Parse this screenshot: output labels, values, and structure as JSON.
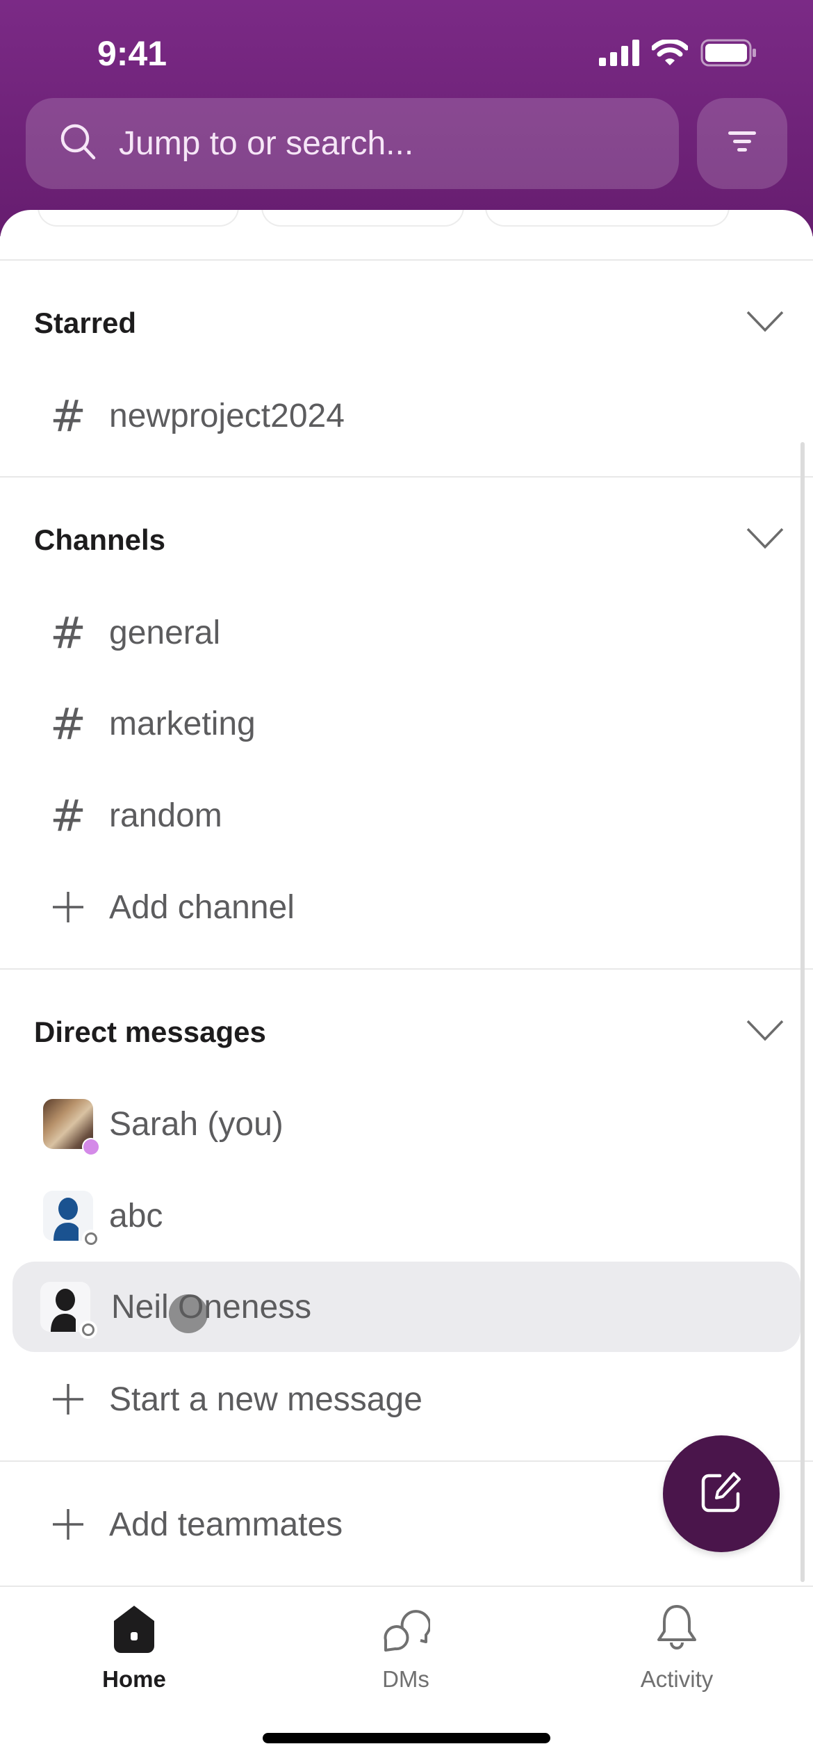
{
  "status_bar": {
    "time": "9:41",
    "signal_icon": "cellular-signal-icon",
    "wifi_icon": "wifi-icon",
    "battery_icon": "battery-icon"
  },
  "search": {
    "placeholder": "Jump to or search...",
    "icon": "search-icon",
    "filter_icon": "filter-icon"
  },
  "sections": {
    "starred": {
      "title": "Starred",
      "items": [
        {
          "icon": "hash-icon",
          "glyph": "#",
          "label": "newproject2024"
        }
      ]
    },
    "channels": {
      "title": "Channels",
      "items": [
        {
          "icon": "hash-icon",
          "glyph": "#",
          "label": "general"
        },
        {
          "icon": "hash-icon",
          "glyph": "#",
          "label": "marketing"
        },
        {
          "icon": "hash-icon",
          "glyph": "#",
          "label": "random"
        },
        {
          "icon": "plus-icon",
          "glyph": "+",
          "label": "Add channel"
        }
      ]
    },
    "direct_messages": {
      "title": "Direct messages",
      "items": [
        {
          "avatar": "photo",
          "presence": "active",
          "label": "Sarah (you)"
        },
        {
          "avatar": "generic-blue",
          "presence": "away",
          "label": "abc"
        },
        {
          "avatar": "generic-black",
          "presence": "away",
          "label": "Neil Oneness",
          "selected": true
        },
        {
          "icon": "plus-icon",
          "glyph": "+",
          "label": "Start a new message"
        }
      ]
    },
    "add_teammates": {
      "glyph": "+",
      "label": "Add teammates"
    }
  },
  "fab": {
    "icon": "compose-icon"
  },
  "tabs": [
    {
      "label": "Home",
      "icon": "home-icon",
      "active": true
    },
    {
      "label": "DMs",
      "icon": "dms-icon",
      "active": false
    },
    {
      "label": "Activity",
      "icon": "bell-icon",
      "active": false
    }
  ],
  "colors": {
    "header_purple": "#7b2a86",
    "fab_aubergine": "#4a154b",
    "presence_active": "#d48ae8",
    "selected_row": "#ebebee",
    "text_secondary": "#5c5c5e",
    "text_primary": "#1d1c1d",
    "user_blue": "#1a5290"
  }
}
